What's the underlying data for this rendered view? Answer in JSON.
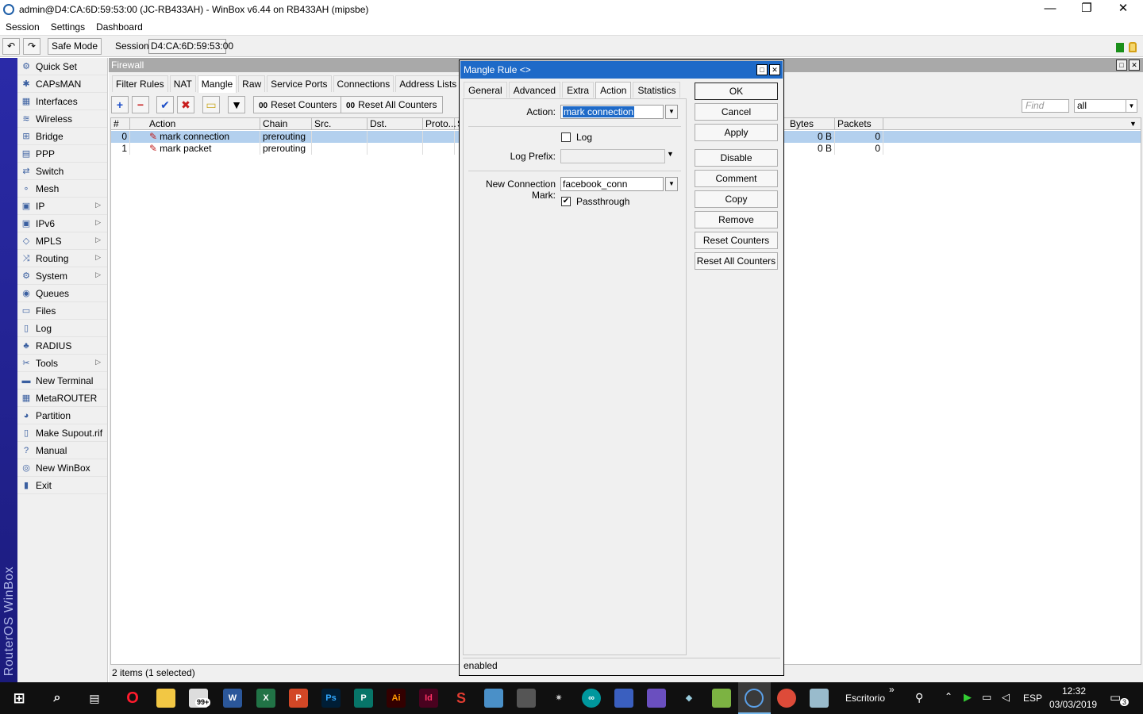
{
  "window": {
    "title": "admin@D4:CA:6D:59:53:00 (JC-RB433AH) - WinBox v6.44 on RB433AH (mipsbe)",
    "minimize": "—",
    "restore": "❐",
    "close": "✕"
  },
  "menu": [
    "Session",
    "Settings",
    "Dashboard"
  ],
  "toolbar": {
    "undo": "↶",
    "redo": "↷",
    "safe_mode": "Safe Mode",
    "session_label": "Session:",
    "session_value": "D4:CA:6D:59:53:00"
  },
  "brand": "RouterOS WinBox",
  "sidebar": [
    {
      "label": "Quick Set",
      "icon": "quick-set-icon",
      "glyph": "⚙",
      "arrow": false
    },
    {
      "label": "CAPsMAN",
      "icon": "capsman-icon",
      "glyph": "✱",
      "arrow": false
    },
    {
      "label": "Interfaces",
      "icon": "interfaces-icon",
      "glyph": "▦",
      "arrow": false
    },
    {
      "label": "Wireless",
      "icon": "wireless-icon",
      "glyph": "≋",
      "arrow": false
    },
    {
      "label": "Bridge",
      "icon": "bridge-icon",
      "glyph": "⊞",
      "arrow": false
    },
    {
      "label": "PPP",
      "icon": "ppp-icon",
      "glyph": "▤",
      "arrow": false
    },
    {
      "label": "Switch",
      "icon": "switch-icon",
      "glyph": "⇄",
      "arrow": false
    },
    {
      "label": "Mesh",
      "icon": "mesh-icon",
      "glyph": "∘",
      "arrow": false
    },
    {
      "label": "IP",
      "icon": "ip-icon",
      "glyph": "▣",
      "arrow": true
    },
    {
      "label": "IPv6",
      "icon": "ipv6-icon",
      "glyph": "▣",
      "arrow": true
    },
    {
      "label": "MPLS",
      "icon": "mpls-icon",
      "glyph": "◇",
      "arrow": true
    },
    {
      "label": "Routing",
      "icon": "routing-icon",
      "glyph": "⤨",
      "arrow": true
    },
    {
      "label": "System",
      "icon": "system-icon",
      "glyph": "⚙",
      "arrow": true
    },
    {
      "label": "Queues",
      "icon": "queues-icon",
      "glyph": "◉",
      "arrow": false
    },
    {
      "label": "Files",
      "icon": "files-icon",
      "glyph": "▭",
      "arrow": false
    },
    {
      "label": "Log",
      "icon": "log-icon",
      "glyph": "▯",
      "arrow": false
    },
    {
      "label": "RADIUS",
      "icon": "radius-icon",
      "glyph": "♣",
      "arrow": false
    },
    {
      "label": "Tools",
      "icon": "tools-icon",
      "glyph": "✂",
      "arrow": true
    },
    {
      "label": "New Terminal",
      "icon": "terminal-icon",
      "glyph": "▬",
      "arrow": false
    },
    {
      "label": "MetaROUTER",
      "icon": "metarouter-icon",
      "glyph": "▦",
      "arrow": false
    },
    {
      "label": "Partition",
      "icon": "partition-icon",
      "glyph": "◕",
      "arrow": false
    },
    {
      "label": "Make Supout.rif",
      "icon": "supout-icon",
      "glyph": "▯",
      "arrow": false
    },
    {
      "label": "Manual",
      "icon": "manual-icon",
      "glyph": "?",
      "arrow": false
    },
    {
      "label": "New WinBox",
      "icon": "winbox-icon",
      "glyph": "◎",
      "arrow": false
    },
    {
      "label": "Exit",
      "icon": "exit-icon",
      "glyph": "▮",
      "arrow": false
    }
  ],
  "firewall": {
    "title": "Firewall",
    "tabs": [
      "Filter Rules",
      "NAT",
      "Mangle",
      "Raw",
      "Service Ports",
      "Connections",
      "Address Lists",
      "Layer7"
    ],
    "active_tab": "Mangle",
    "tools": {
      "add": "+",
      "remove": "−",
      "enable": "✔",
      "disable": "✖",
      "comment": "▭",
      "filter": "▼",
      "reset_counters": "Reset Counters",
      "reset_all_counters": "Reset All Counters",
      "counter_glyph": "00"
    },
    "find_placeholder": "Find",
    "filter_value": "all",
    "columns": [
      "#",
      "Action",
      "Chain",
      "Src. Address",
      "Dst. Address",
      "Proto...",
      "S",
      "Bytes",
      "Packets"
    ],
    "rows": [
      {
        "num": "0",
        "action": "mark connection",
        "chain": "prerouting",
        "bytes": "0 B",
        "packets": "0",
        "selected": true
      },
      {
        "num": "1",
        "action": "mark packet",
        "chain": "prerouting",
        "bytes": "0 B",
        "packets": "0",
        "selected": false
      }
    ],
    "status": "2 items (1 selected)"
  },
  "dialog": {
    "title": "Mangle Rule <>",
    "tabs": [
      "General",
      "Advanced",
      "Extra",
      "Action",
      "Statistics"
    ],
    "active_tab": "Action",
    "action_label": "Action:",
    "action_value": "mark connection",
    "log_label": "Log",
    "log_checked": false,
    "log_prefix_label": "Log Prefix:",
    "log_prefix_value": "",
    "new_conn_mark_label": "New Connection Mark:",
    "new_conn_mark_value": "facebook_conn",
    "passthrough_label": "Passthrough",
    "passthrough_checked": "✔",
    "buttons": [
      "OK",
      "Cancel",
      "Apply",
      "Disable",
      "Comment",
      "Copy",
      "Remove",
      "Reset Counters",
      "Reset All Counters"
    ],
    "status": "enabled"
  },
  "taskbar": {
    "location": "Escritorio",
    "chevron": "»",
    "language": "ESP",
    "time": "12:32",
    "date": "03/03/2019",
    "notification_count": "3",
    "mail_badge": "99+"
  }
}
